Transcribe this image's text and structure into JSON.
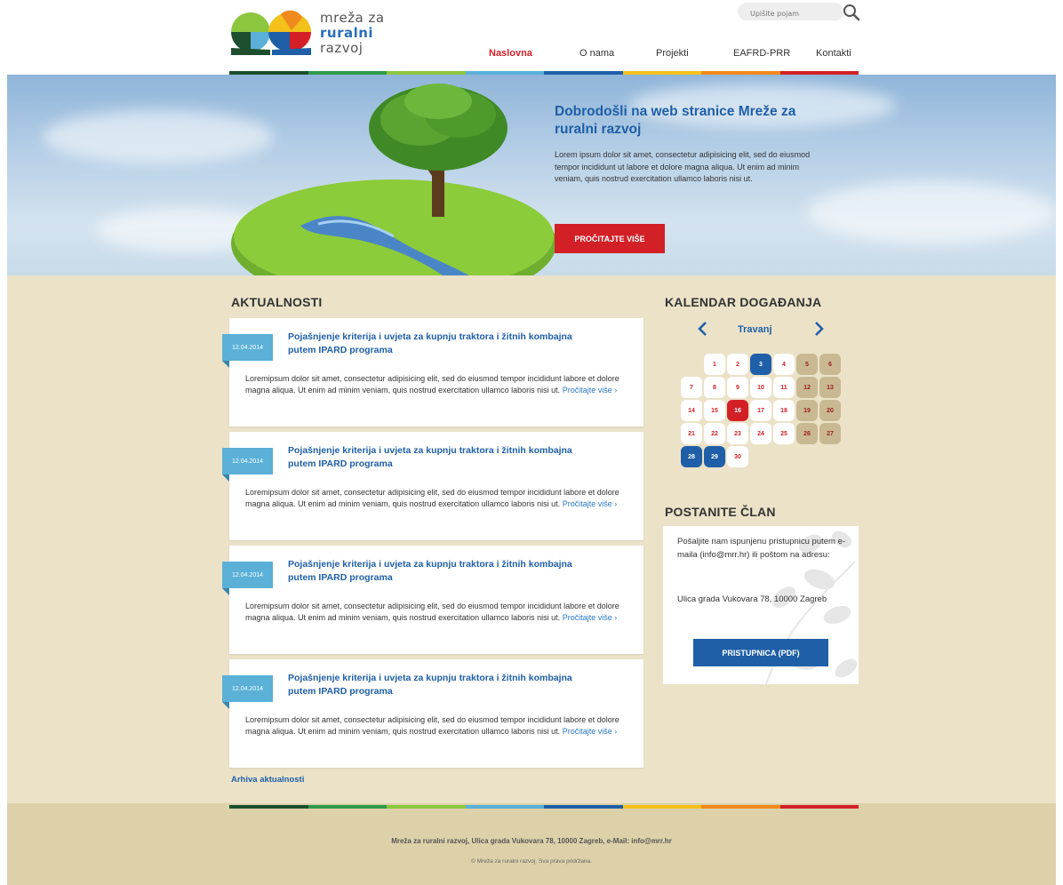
{
  "header": {
    "logo_line1": "mreža za",
    "logo_line2": "ruralni",
    "logo_line3": "razvoj",
    "search_placeholder": "Upišite pojam",
    "nav": [
      "Naslovna",
      "O nama",
      "Projekti",
      "EAFRD-PRR",
      "Kontakti"
    ],
    "active_nav": "Naslovna"
  },
  "stripe_colors": [
    "#1d4e2e",
    "#2f9a4a",
    "#8cc63f",
    "#5ab0d7",
    "#1f5fa8",
    "#f3c11a",
    "#f08a1d",
    "#d32027"
  ],
  "hero": {
    "title": "Dobrodošli na web stranice Mreže za ruralni razvoj",
    "text": "Lorem ipsum dolor sit amet, consectetur adipisicing elit, sed do eiusmod tempor incididunt ut labore et dolore magna aliqua. Ut enim ad minim veniam, quis nostrud exercitation ullamco laboris nisi ut.",
    "button": "PROČITAJTE VIŠE"
  },
  "news": {
    "title": "AKTUALNOSTI",
    "items": [
      {
        "date": "12.04.2014",
        "title": "Pojašnjenje kriterija i uvjeta za kupnju traktora i žitnih kombajna putem IPARD programa",
        "body": "Loremipsum dolor sit amet, consectetur adipisicing elit, sed do eiusmod tempor incididunt labore et dolore magna aliqua. Ut enim ad minim veniam, quis nostrud exercitation ullamco laboris nisi ut.",
        "more": "Pročitajte više ›"
      },
      {
        "date": "12.04.2014",
        "title": "Pojašnjenje kriterija i uvjeta za kupnju traktora i žitnih kombajna putem IPARD programa",
        "body": "Loremipsum dolor sit amet, consectetur adipisicing elit, sed do eiusmod tempor incididunt labore et dolore magna aliqua. Ut enim ad minim veniam, quis nostrud exercitation ullamco laboris nisi ut.",
        "more": "Pročitajte više ›"
      },
      {
        "date": "12.04.2014",
        "title": "Pojašnjenje kriterija i uvjeta za kupnju traktora i žitnih kombajna putem IPARD programa",
        "body": "Loremipsum dolor sit amet, consectetur adipisicing elit, sed do eiusmod tempor incididunt labore et dolore magna aliqua. Ut enim ad minim veniam, quis nostrud exercitation ullamco laboris nisi ut.",
        "more": "Pročitajte više ›"
      },
      {
        "date": "12.04.2014",
        "title": "Pojašnjenje kriterija i uvjeta za kupnju traktora i žitnih kombajna putem IPARD programa",
        "body": "Loremipsum dolor sit amet, consectetur adipisicing elit, sed do eiusmod tempor incididunt labore et dolore magna aliqua. Ut enim ad minim veniam, quis nostrud exercitation ullamco laboris nisi ut.",
        "more": "Pročitajte više ›"
      }
    ],
    "archive": "Arhiva aktualnosti"
  },
  "calendar": {
    "title": "KALENDAR DOGAĐANJA",
    "month": "Travanj",
    "prev": "‹",
    "next": "›",
    "days": [
      {
        "d": "1",
        "type": "normal"
      },
      {
        "d": "2",
        "type": "normal"
      },
      {
        "d": "3",
        "type": "blue"
      },
      {
        "d": "4",
        "type": "normal"
      },
      {
        "d": "5",
        "type": "weekend"
      },
      {
        "d": "6",
        "type": "weekend"
      },
      {
        "d": "7",
        "type": "normal"
      },
      {
        "d": "8",
        "type": "normal"
      },
      {
        "d": "9",
        "type": "normal"
      },
      {
        "d": "10",
        "type": "normal"
      },
      {
        "d": "11",
        "type": "normal"
      },
      {
        "d": "12",
        "type": "weekend"
      },
      {
        "d": "13",
        "type": "weekend"
      },
      {
        "d": "14",
        "type": "normal"
      },
      {
        "d": "15",
        "type": "normal"
      },
      {
        "d": "16",
        "type": "red"
      },
      {
        "d": "17",
        "type": "normal"
      },
      {
        "d": "18",
        "type": "normal"
      },
      {
        "d": "19",
        "type": "weekend"
      },
      {
        "d": "20",
        "type": "weekend"
      },
      {
        "d": "21",
        "type": "normal"
      },
      {
        "d": "22",
        "type": "normal"
      },
      {
        "d": "23",
        "type": "normal"
      },
      {
        "d": "24",
        "type": "normal"
      },
      {
        "d": "25",
        "type": "normal"
      },
      {
        "d": "26",
        "type": "weekend"
      },
      {
        "d": "27",
        "type": "weekend"
      },
      {
        "d": "28",
        "type": "blue"
      },
      {
        "d": "29",
        "type": "blue"
      },
      {
        "d": "30",
        "type": "normal"
      }
    ]
  },
  "member": {
    "title": "POSTANITE ČLAN",
    "text": "Pošaljite nam ispunjenu pristupnicu putem e-maila (info@mrr.hr) ili poštom na adresu:",
    "address": "Ulica grada Vukovara 78, 10000 Zagreb",
    "button": "PRISTUPNICA (PDF)"
  },
  "footer": {
    "line1": "Mreža za ruralni razvoj, Ulica grada Vukovara 78, 10000 Zagreb, e-Mail: info@mrr.hr",
    "line2": "© Mreža za ruralni razvoj. Sva prava pridržana."
  }
}
